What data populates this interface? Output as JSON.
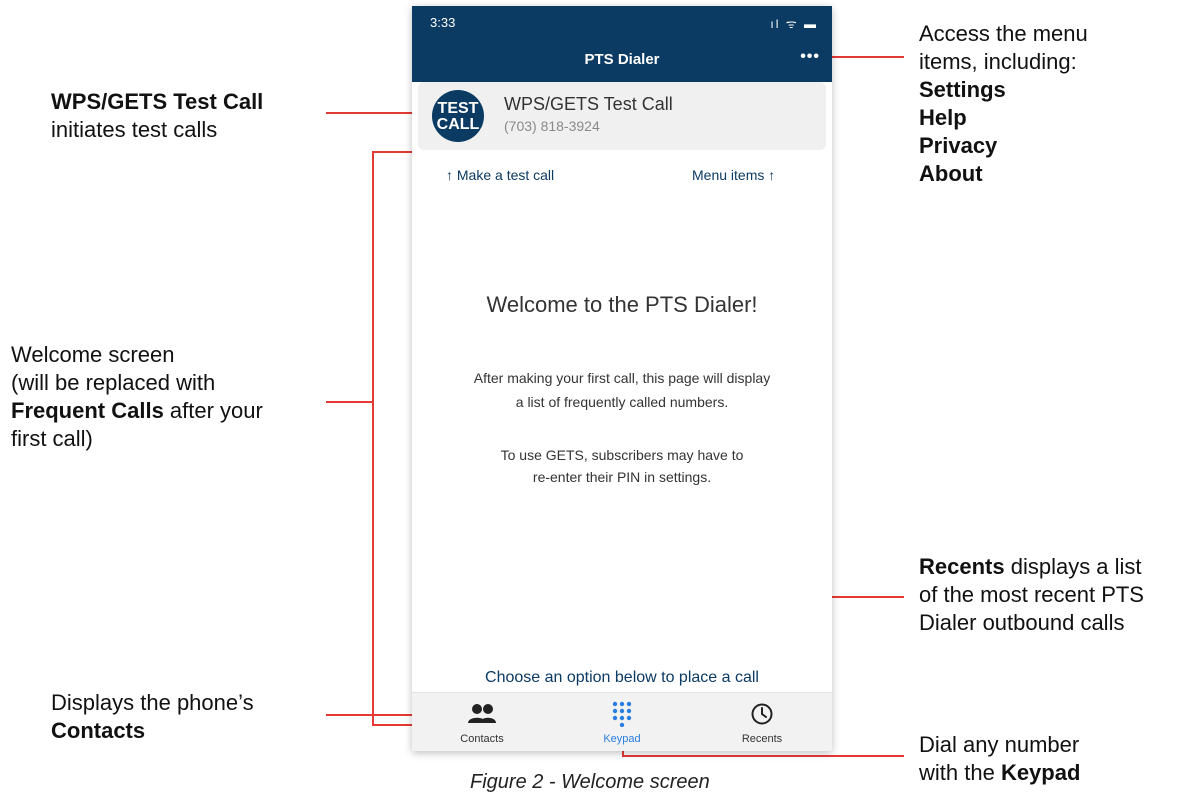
{
  "phone": {
    "status_time": "3:33",
    "status_icons": "ıl ᯤ ▬",
    "nav_title": "PTS Dialer",
    "more_menu": "•••",
    "test_call": {
      "avatar_line1": "TEST",
      "avatar_line2": "CALL",
      "title": "WPS/GETS Test Call",
      "phone": "(703) 818-3924"
    },
    "hint_left": "↑  Make a test call",
    "hint_right": "Menu items  ↑",
    "welcome_title": "Welcome to the PTS Dialer!",
    "welcome_line1": "After making your first call, this page will display",
    "welcome_line2": "a list of frequently called numbers.",
    "gets_line1": "To use GETS, subscribers may have to",
    "gets_line2": "re-enter their PIN in settings.",
    "choose_text": "Choose an option below to place a call",
    "tabs": [
      {
        "label": "Contacts",
        "icon": "contacts-icon"
      },
      {
        "label": "Keypad",
        "icon": "keypad-icon"
      },
      {
        "label": "Recents",
        "icon": "clock-icon"
      }
    ]
  },
  "annotations": {
    "test_call_bold": "WPS/GETS Test Call",
    "test_call_rest": "initiates test calls",
    "menu_line1": "Access the menu",
    "menu_line2": "items, including:",
    "menu_items": [
      "Settings",
      "Help",
      "Privacy",
      "About"
    ],
    "welcome_line1": "Welcome screen",
    "welcome_line2": "(will be replaced with",
    "welcome_bold": "Frequent Calls",
    "welcome_rest": " after your",
    "welcome_line4": "first call)",
    "recents_bold": "Recents",
    "recents_rest": " displays a list",
    "recents_line2": "of the most recent PTS",
    "recents_line3": "Dialer outbound calls",
    "contacts_line1": "Displays the phone’s",
    "contacts_bold": "Contacts",
    "keypad_line1": "Dial any number",
    "keypad_rest": "with the ",
    "keypad_bold": "Keypad"
  },
  "caption": "Figure 2 - Welcome screen",
  "colors": {
    "nav": "#0b3a63",
    "annotation_line": "#e53935",
    "active_tab": "#2a7de1"
  }
}
